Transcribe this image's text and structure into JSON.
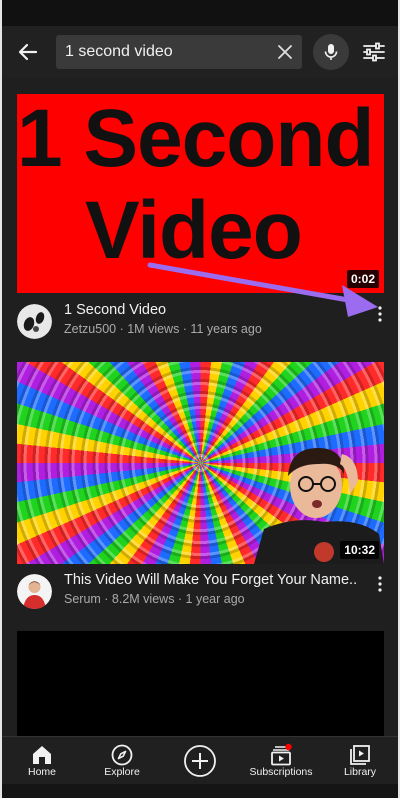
{
  "search": {
    "query": "1 second video"
  },
  "results": [
    {
      "thumbnail_text_line1": "1 Second",
      "thumbnail_text_line2": "Video",
      "duration": "0:02",
      "title": "1 Second Video",
      "channel_line": "Zetzu500 · 1M views · 11 years ago",
      "thumbnail_color": "#ff0000"
    },
    {
      "duration": "10:32",
      "title": "This Video Will Make You Forget Your Name..",
      "channel_line": "Serum · 8.2M views · 1 year ago"
    }
  ],
  "annotation": {
    "arrow_color": "#9b6cf0"
  },
  "nav": {
    "home": "Home",
    "explore": "Explore",
    "subscriptions": "Subscriptions",
    "library": "Library"
  },
  "icons": [
    "back-arrow-icon",
    "clear-icon",
    "mic-icon",
    "filter-icon",
    "more-vert-icon",
    "home-icon",
    "compass-icon",
    "add-circle-icon",
    "subscriptions-icon",
    "library-icon"
  ]
}
